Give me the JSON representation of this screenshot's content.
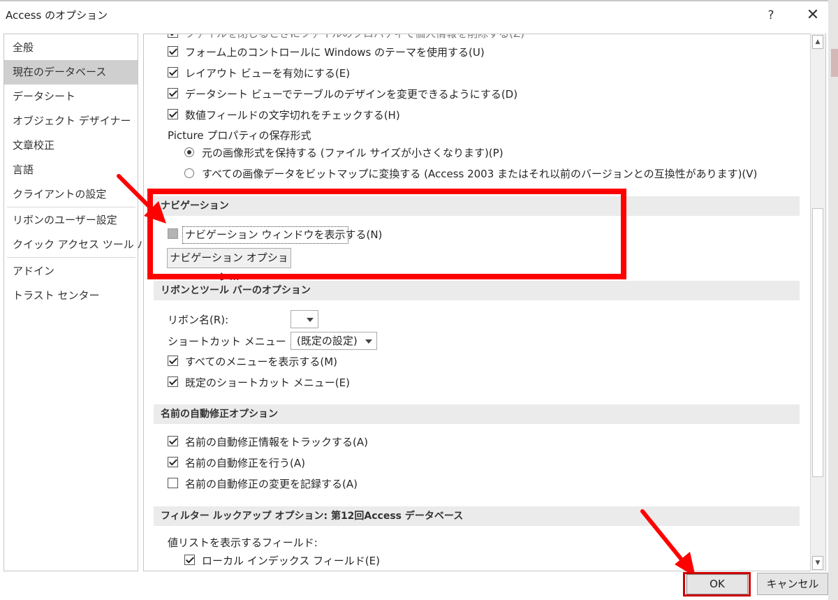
{
  "window": {
    "title": "Access のオプション",
    "help_label": "?",
    "close_label": "✕"
  },
  "sidebar": {
    "items": [
      {
        "label": "全般",
        "selected": false
      },
      {
        "label": "現在のデータベース",
        "selected": true
      },
      {
        "label": "データシート",
        "selected": false
      },
      {
        "label": "オブジェクト デザイナー",
        "selected": false
      },
      {
        "label": "文章校正",
        "selected": false
      },
      {
        "label": "言語",
        "selected": false
      },
      {
        "label": "クライアントの設定",
        "selected": false
      },
      {
        "label": "リボンのユーザー設定",
        "selected": false
      },
      {
        "label": "クイック アクセス ツール バー",
        "selected": false
      },
      {
        "label": "アドイン",
        "selected": false
      },
      {
        "label": "トラスト センター",
        "selected": false
      }
    ]
  },
  "main": {
    "partial_top": "ファイルを閉じるときにファイルのプロパティで個人情報を削除する(Z)",
    "options_top": [
      {
        "label": "フォーム上のコントロールに Windows のテーマを使用する(U)",
        "checked": true
      },
      {
        "label": "レイアウト ビューを有効にする(E)",
        "checked": true
      },
      {
        "label": "データシート ビューでテーブルのデザインを変更できるようにする(D)",
        "checked": true
      },
      {
        "label": "数値フィールドの文字切れをチェックする(H)",
        "checked": true
      }
    ],
    "picture_label": "Picture プロパティの保存形式",
    "picture_options": [
      {
        "label": "元の画像形式を保持する (ファイル サイズが小さくなります)(P)",
        "selected": true
      },
      {
        "label": "すべての画像データをビットマップに変換する (Access 2003 またはそれ以前のバージョンとの互換性があります)(V)",
        "selected": false
      }
    ],
    "navigation": {
      "header": "ナビゲーション",
      "show_pane_label": "ナビゲーション ウィンドウを表示する(N)",
      "show_pane_checked": false,
      "options_button": "ナビゲーション オプション..."
    },
    "ribbon": {
      "header": "リボンとツール バーのオプション",
      "ribbon_name_label": "リボン名(R):",
      "ribbon_name_value": "",
      "shortcut_menu_label": "ショートカット メニュー バー:",
      "shortcut_menu_value": "(既定の設定)",
      "options": [
        {
          "label": "すべてのメニューを表示する(M)",
          "checked": true
        },
        {
          "label": "既定のショートカット メニュー(E)",
          "checked": true
        }
      ]
    },
    "autocorrect": {
      "header": "名前の自動修正オプション",
      "options": [
        {
          "label": "名前の自動修正情報をトラックする(A)",
          "checked": true
        },
        {
          "label": "名前の自動修正を行う(A)",
          "checked": true
        },
        {
          "label": "名前の自動修正の変更を記録する(A)",
          "checked": false
        }
      ]
    },
    "filter": {
      "header": "フィルター ルックアップ オプション: 第12回Access データベース",
      "value_list_label": "値リストを表示するフィールド:",
      "local_index_label": "ローカル インデックス フィールド(E)",
      "local_index_checked": true
    }
  },
  "footer": {
    "ok_label": "OK",
    "cancel_label": "キャンセル"
  },
  "annotations": {
    "highlight_color": "#ff0000"
  }
}
